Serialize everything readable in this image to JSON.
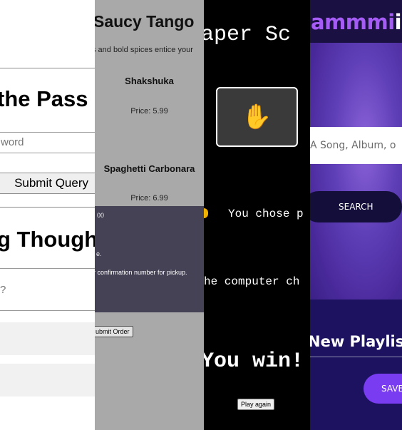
{
  "password_app": {
    "heading": "the Pass",
    "password_placeholder": "word",
    "submit_label": "Submit Query",
    "thoughts_heading": "g Thought",
    "thought_placeholder": "?"
  },
  "restaurant": {
    "title": "Saucy Tango",
    "subtitle": "s and bold spices entice your",
    "items": [
      {
        "name": "Shakshuka",
        "price": "Price: 5.99"
      },
      {
        "name": "Spaghetti Carbonara",
        "price": "Price: 6.99"
      }
    ],
    "modal": {
      "number_fragment": "00",
      "dot": "e.",
      "message": "r confirmation number for pickup."
    },
    "order_button": "ubmit Order"
  },
  "rps_game": {
    "title": "aper Sc",
    "choice_icon": "raised-hand-icon",
    "player_choice": "You chose p",
    "computer_choice": "he computer ch",
    "result": "You win!",
    "play_again": "Play again"
  },
  "music_app": {
    "brand_main": "ammmi",
    "brand_tail": "ir",
    "search_placeholder": "A Song, Album, o",
    "search_button": "SEARCH",
    "playlist_title": "New Playlis",
    "save_button": "SAVE",
    "accent_color": "#a45cf5"
  }
}
